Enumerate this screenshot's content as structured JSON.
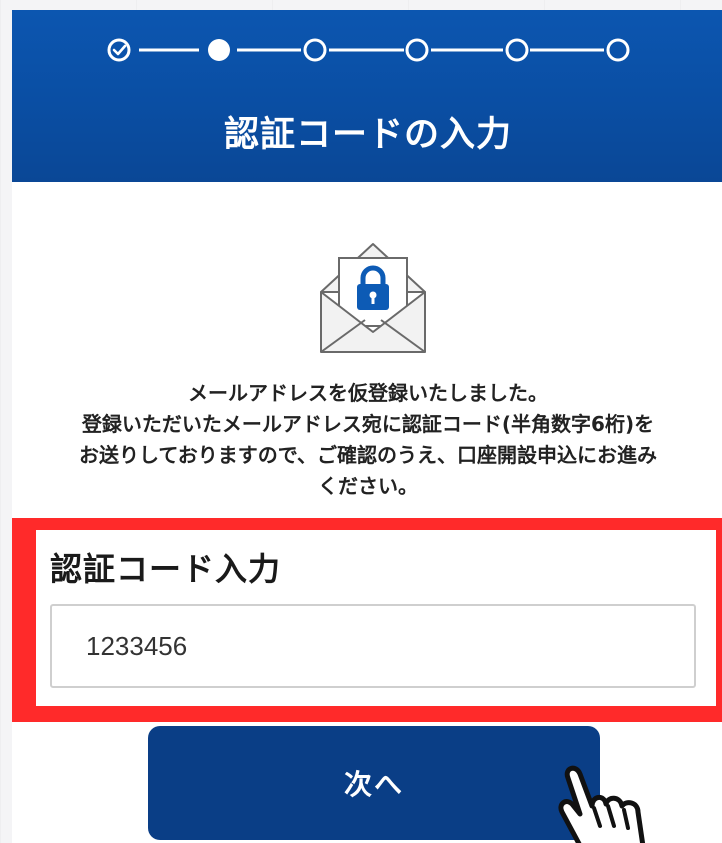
{
  "stepper": {
    "steps": [
      "completed",
      "current",
      "pending",
      "pending",
      "pending",
      "pending"
    ]
  },
  "header": {
    "title": "認証コードの入力"
  },
  "envelope": {
    "icon": "lock-envelope-icon"
  },
  "message": {
    "lines": [
      "メールアドレスを仮登録いたしました。",
      "登録いただいたメールアドレス宛に認証コード(半角数字6桁)を",
      "お送りしておりますので、ご確認のうえ、口座開設申込にお進み",
      "ください。"
    ]
  },
  "code_entry": {
    "label": "認証コード入力",
    "value": "1233456",
    "highlight_color": "#ff2a2a"
  },
  "next_button": {
    "label": "次へ"
  },
  "colors": {
    "header_blue": "#0a4ea3",
    "button_navy": "#0a3e86",
    "lock_blue": "#0d5bb5"
  }
}
